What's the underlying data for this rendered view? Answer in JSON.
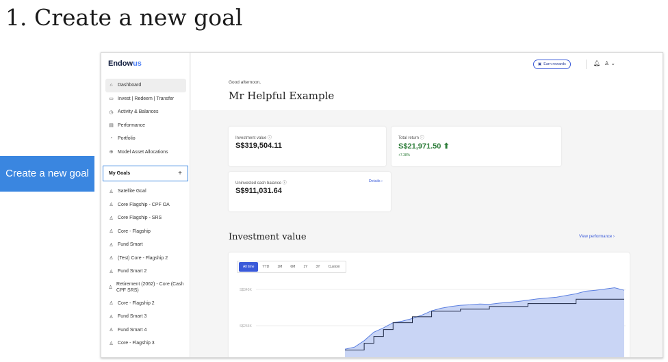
{
  "heading": "1. Create a new goal",
  "callout": "Create a new goal",
  "app": {
    "logo_main": "Endow",
    "logo_accent": "us",
    "earn_rewards": "Earn rewards",
    "nav": [
      {
        "label": "Dashboard",
        "icon": "home-icon",
        "active": true
      },
      {
        "label": "Invest | Redeem | Transfer",
        "icon": "wallet-icon"
      },
      {
        "label": "Activity & Balances",
        "icon": "clock-icon"
      },
      {
        "label": "Performance",
        "icon": "chart-icon"
      },
      {
        "label": "Portfolio",
        "icon": "pie-icon"
      },
      {
        "label": "Model Asset Allocations",
        "icon": "allocation-icon"
      }
    ],
    "goals_title": "My Goals",
    "goals_plus": "+",
    "goals": [
      "Satellite Goal",
      "Core Flagship - CPF OA",
      "Core Flagship - SRS",
      "Core - Flagship",
      "Fund Smart",
      "(Test) Core - Flagship 2",
      "Fund Smart 2",
      "Retirement (2062) - Core (Cash CPF SRS)",
      "Core - Flagship 2",
      "Fund Smart 3",
      "Fund Smart 4",
      "Core - Flagship 3"
    ],
    "greeting": "Good afternoon,",
    "user_name": "Mr Helpful Example",
    "cards": {
      "investment_label": "Investment value ⓘ",
      "investment_value": "S$319,504.11",
      "return_label": "Total return ⓘ",
      "return_value": "S$21,971.50 ⬆",
      "return_pct": "+7.38%",
      "cash_label": "Uninvested cash balance ⓘ",
      "cash_value": "S$911,031.64",
      "details": "Details ›"
    },
    "section_title": "Investment value",
    "view_performance": "View performance ›",
    "ranges": [
      "All time",
      "YTD",
      "1M",
      "6M",
      "1Y",
      "3Y",
      "Custom"
    ],
    "active_range": "All time",
    "y_ticks": [
      "S$340K",
      "S$255K"
    ]
  },
  "chart_data": {
    "type": "area",
    "y_ticks": [
      "S$340K",
      "S$255K"
    ],
    "series": [
      {
        "values": [
          200,
          205,
          220,
          240,
          250,
          262,
          266,
          272,
          280,
          290,
          296,
          300,
          303,
          304,
          306,
          305,
          308,
          310,
          312,
          315,
          318,
          320,
          322,
          326,
          330,
          336,
          338,
          341,
          344,
          338
        ]
      },
      {
        "values": [
          198,
          198,
          214,
          230,
          246,
          262,
          262,
          276,
          276,
          289,
          289,
          289,
          294,
          294,
          294,
          300,
          300,
          300,
          300,
          307,
          307,
          307,
          307,
          307,
          317,
          317,
          317,
          317,
          317,
          317
        ]
      }
    ]
  },
  "colors": {
    "accent": "#3a5ad9",
    "callout": "#3a86e0",
    "positive": "#2e7d3a",
    "area_fill": "#c9d5f5",
    "line_top": "#5b7fe0",
    "line_step": "#1a2440"
  }
}
